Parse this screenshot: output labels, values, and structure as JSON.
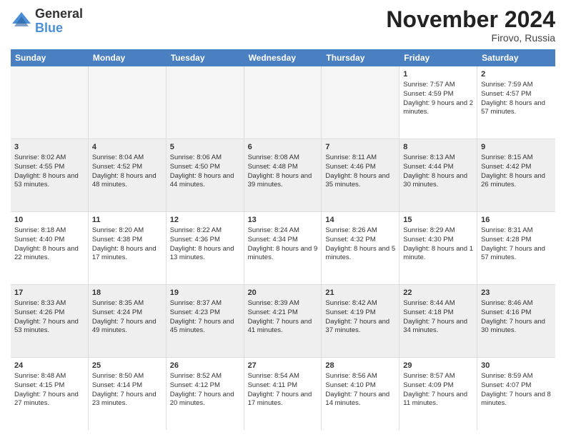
{
  "logo": {
    "general": "General",
    "blue": "Blue"
  },
  "title": "November 2024",
  "location": "Firovo, Russia",
  "weekdays": [
    "Sunday",
    "Monday",
    "Tuesday",
    "Wednesday",
    "Thursday",
    "Friday",
    "Saturday"
  ],
  "rows": [
    [
      {
        "day": "",
        "empty": true
      },
      {
        "day": "",
        "empty": true
      },
      {
        "day": "",
        "empty": true
      },
      {
        "day": "",
        "empty": true
      },
      {
        "day": "",
        "empty": true
      },
      {
        "day": "1",
        "sunrise": "Sunrise: 7:57 AM",
        "sunset": "Sunset: 4:59 PM",
        "daylight": "Daylight: 9 hours and 2 minutes."
      },
      {
        "day": "2",
        "sunrise": "Sunrise: 7:59 AM",
        "sunset": "Sunset: 4:57 PM",
        "daylight": "Daylight: 8 hours and 57 minutes."
      }
    ],
    [
      {
        "day": "3",
        "sunrise": "Sunrise: 8:02 AM",
        "sunset": "Sunset: 4:55 PM",
        "daylight": "Daylight: 8 hours and 53 minutes."
      },
      {
        "day": "4",
        "sunrise": "Sunrise: 8:04 AM",
        "sunset": "Sunset: 4:52 PM",
        "daylight": "Daylight: 8 hours and 48 minutes."
      },
      {
        "day": "5",
        "sunrise": "Sunrise: 8:06 AM",
        "sunset": "Sunset: 4:50 PM",
        "daylight": "Daylight: 8 hours and 44 minutes."
      },
      {
        "day": "6",
        "sunrise": "Sunrise: 8:08 AM",
        "sunset": "Sunset: 4:48 PM",
        "daylight": "Daylight: 8 hours and 39 minutes."
      },
      {
        "day": "7",
        "sunrise": "Sunrise: 8:11 AM",
        "sunset": "Sunset: 4:46 PM",
        "daylight": "Daylight: 8 hours and 35 minutes."
      },
      {
        "day": "8",
        "sunrise": "Sunrise: 8:13 AM",
        "sunset": "Sunset: 4:44 PM",
        "daylight": "Daylight: 8 hours and 30 minutes."
      },
      {
        "day": "9",
        "sunrise": "Sunrise: 8:15 AM",
        "sunset": "Sunset: 4:42 PM",
        "daylight": "Daylight: 8 hours and 26 minutes."
      }
    ],
    [
      {
        "day": "10",
        "sunrise": "Sunrise: 8:18 AM",
        "sunset": "Sunset: 4:40 PM",
        "daylight": "Daylight: 8 hours and 22 minutes."
      },
      {
        "day": "11",
        "sunrise": "Sunrise: 8:20 AM",
        "sunset": "Sunset: 4:38 PM",
        "daylight": "Daylight: 8 hours and 17 minutes."
      },
      {
        "day": "12",
        "sunrise": "Sunrise: 8:22 AM",
        "sunset": "Sunset: 4:36 PM",
        "daylight": "Daylight: 8 hours and 13 minutes."
      },
      {
        "day": "13",
        "sunrise": "Sunrise: 8:24 AM",
        "sunset": "Sunset: 4:34 PM",
        "daylight": "Daylight: 8 hours and 9 minutes."
      },
      {
        "day": "14",
        "sunrise": "Sunrise: 8:26 AM",
        "sunset": "Sunset: 4:32 PM",
        "daylight": "Daylight: 8 hours and 5 minutes."
      },
      {
        "day": "15",
        "sunrise": "Sunrise: 8:29 AM",
        "sunset": "Sunset: 4:30 PM",
        "daylight": "Daylight: 8 hours and 1 minute."
      },
      {
        "day": "16",
        "sunrise": "Sunrise: 8:31 AM",
        "sunset": "Sunset: 4:28 PM",
        "daylight": "Daylight: 7 hours and 57 minutes."
      }
    ],
    [
      {
        "day": "17",
        "sunrise": "Sunrise: 8:33 AM",
        "sunset": "Sunset: 4:26 PM",
        "daylight": "Daylight: 7 hours and 53 minutes."
      },
      {
        "day": "18",
        "sunrise": "Sunrise: 8:35 AM",
        "sunset": "Sunset: 4:24 PM",
        "daylight": "Daylight: 7 hours and 49 minutes."
      },
      {
        "day": "19",
        "sunrise": "Sunrise: 8:37 AM",
        "sunset": "Sunset: 4:23 PM",
        "daylight": "Daylight: 7 hours and 45 minutes."
      },
      {
        "day": "20",
        "sunrise": "Sunrise: 8:39 AM",
        "sunset": "Sunset: 4:21 PM",
        "daylight": "Daylight: 7 hours and 41 minutes."
      },
      {
        "day": "21",
        "sunrise": "Sunrise: 8:42 AM",
        "sunset": "Sunset: 4:19 PM",
        "daylight": "Daylight: 7 hours and 37 minutes."
      },
      {
        "day": "22",
        "sunrise": "Sunrise: 8:44 AM",
        "sunset": "Sunset: 4:18 PM",
        "daylight": "Daylight: 7 hours and 34 minutes."
      },
      {
        "day": "23",
        "sunrise": "Sunrise: 8:46 AM",
        "sunset": "Sunset: 4:16 PM",
        "daylight": "Daylight: 7 hours and 30 minutes."
      }
    ],
    [
      {
        "day": "24",
        "sunrise": "Sunrise: 8:48 AM",
        "sunset": "Sunset: 4:15 PM",
        "daylight": "Daylight: 7 hours and 27 minutes."
      },
      {
        "day": "25",
        "sunrise": "Sunrise: 8:50 AM",
        "sunset": "Sunset: 4:14 PM",
        "daylight": "Daylight: 7 hours and 23 minutes."
      },
      {
        "day": "26",
        "sunrise": "Sunrise: 8:52 AM",
        "sunset": "Sunset: 4:12 PM",
        "daylight": "Daylight: 7 hours and 20 minutes."
      },
      {
        "day": "27",
        "sunrise": "Sunrise: 8:54 AM",
        "sunset": "Sunset: 4:11 PM",
        "daylight": "Daylight: 7 hours and 17 minutes."
      },
      {
        "day": "28",
        "sunrise": "Sunrise: 8:56 AM",
        "sunset": "Sunset: 4:10 PM",
        "daylight": "Daylight: 7 hours and 14 minutes."
      },
      {
        "day": "29",
        "sunrise": "Sunrise: 8:57 AM",
        "sunset": "Sunset: 4:09 PM",
        "daylight": "Daylight: 7 hours and 11 minutes."
      },
      {
        "day": "30",
        "sunrise": "Sunrise: 8:59 AM",
        "sunset": "Sunset: 4:07 PM",
        "daylight": "Daylight: 7 hours and 8 minutes."
      }
    ]
  ]
}
